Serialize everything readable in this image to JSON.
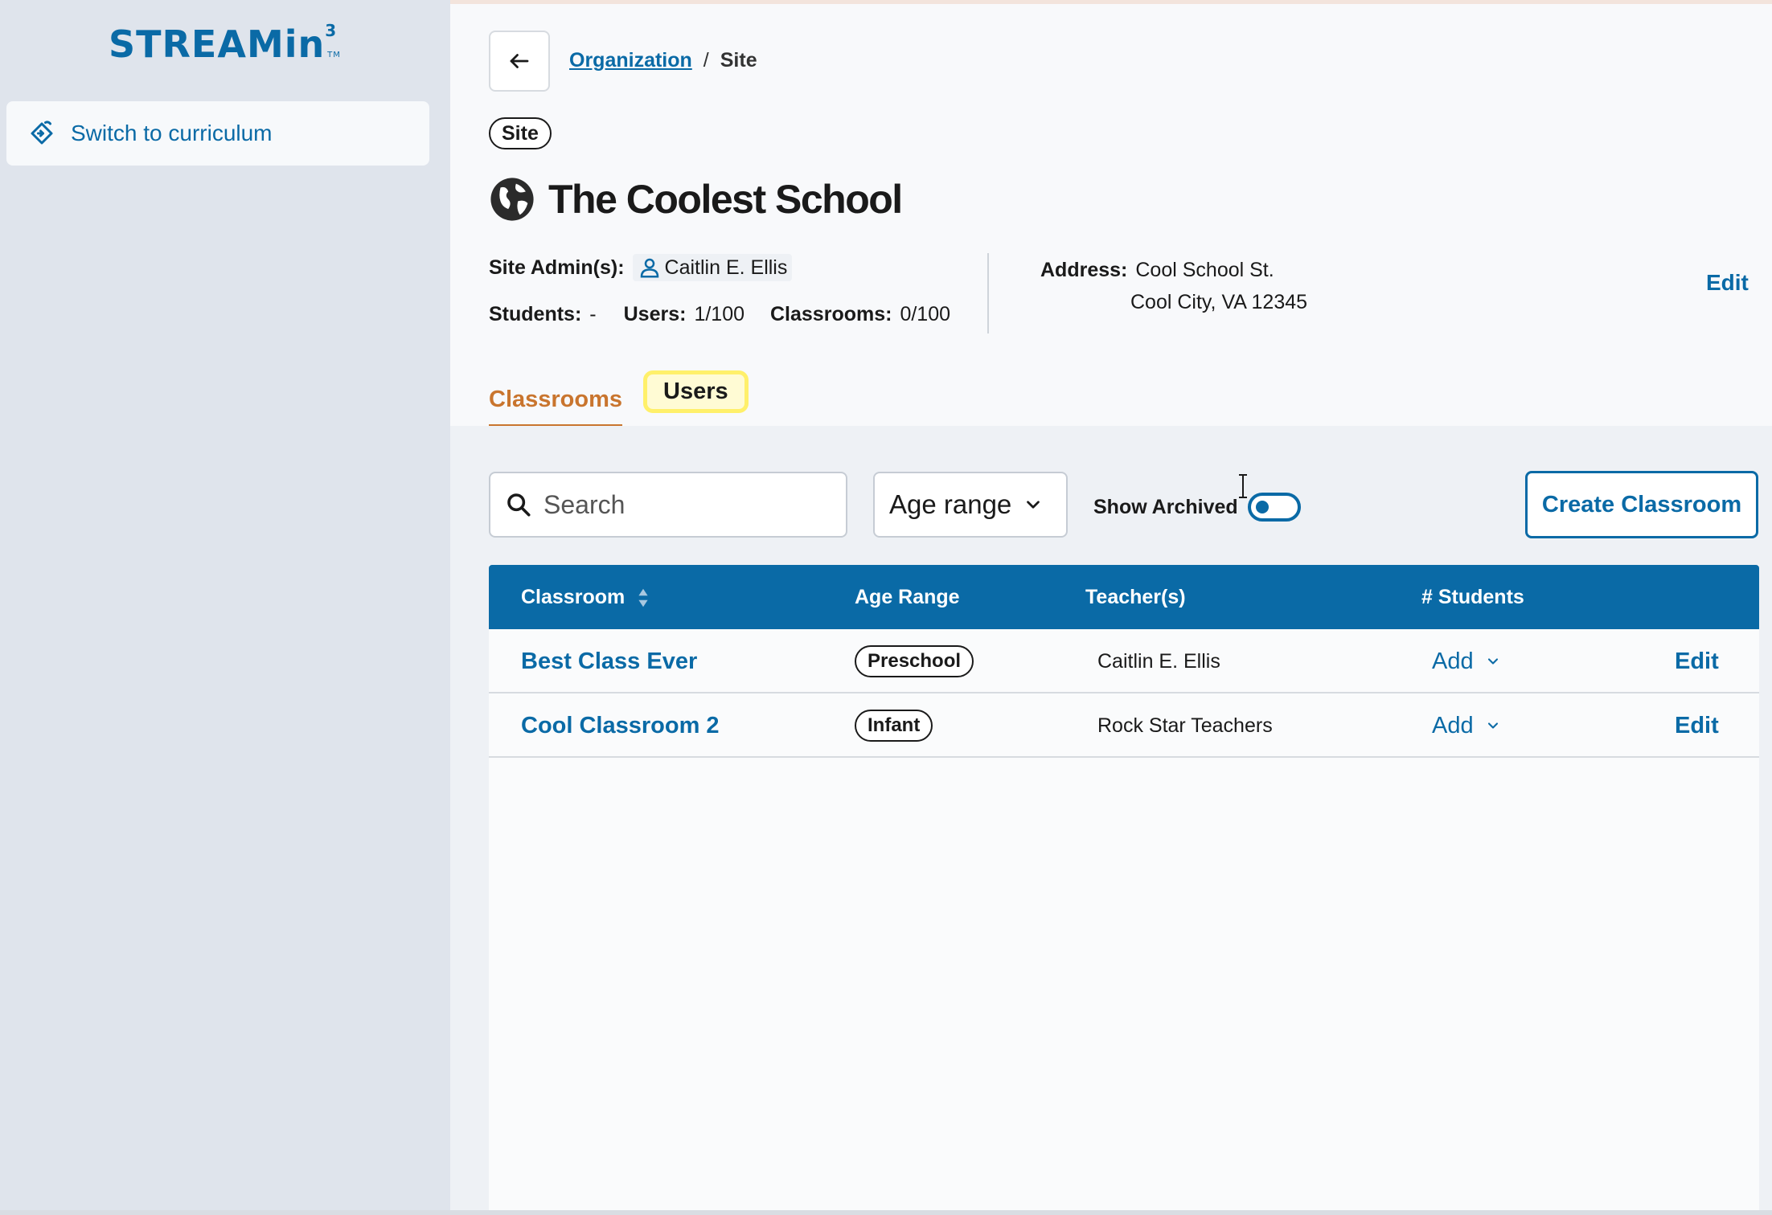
{
  "sidebar": {
    "logo": "STREAMin",
    "logo_sup": "3",
    "logo_tm": "TM",
    "switch_label": "Switch to curriculum"
  },
  "breadcrumb": {
    "parent": "Organization",
    "separator": "/",
    "current": "Site"
  },
  "site": {
    "badge": "Site",
    "title": "The Coolest School",
    "admins_label": "Site Admin(s):",
    "admin_name": "Caitlin E. Ellis",
    "students_label": "Students:",
    "students_value": "-",
    "users_label": "Users:",
    "users_value": "1/100",
    "classrooms_label": "Classrooms:",
    "classrooms_value": "0/100",
    "address_label": "Address:",
    "address_line1": "Cool School St.",
    "address_line2": "Cool City, VA 12345",
    "edit_label": "Edit"
  },
  "tabs": [
    {
      "label": "Classrooms",
      "active": true
    },
    {
      "label": "Users",
      "active": false,
      "highlighted": true
    }
  ],
  "filters": {
    "search_placeholder": "Search",
    "age_range_label": "Age range",
    "show_archived_label": "Show Archived",
    "show_archived_on": false,
    "create_label": "Create Classroom"
  },
  "table": {
    "headers": [
      "Classroom",
      "Age Range",
      "Teacher(s)",
      "# Students"
    ],
    "rows": [
      {
        "classroom": "Best Class Ever",
        "age_range": "Preschool",
        "teachers": "Caitlin E. Ellis",
        "students": "Add",
        "action": "Edit"
      },
      {
        "classroom": "Cool Classroom 2",
        "age_range": "Infant",
        "teachers": "Rock Star Teachers",
        "students": "Add",
        "action": "Edit"
      }
    ]
  },
  "colors": {
    "brand": "#0a6aa6",
    "tab_active": "#c9752e",
    "highlight": "#fff06a"
  }
}
